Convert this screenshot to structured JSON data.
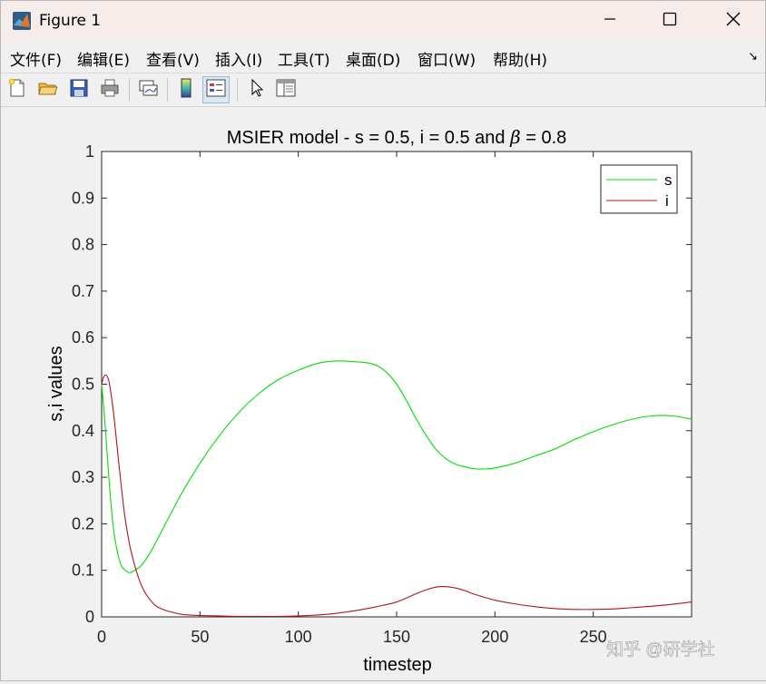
{
  "window": {
    "title": "Figure 1",
    "icon": "matlab-logo-icon",
    "controls": [
      "minimize-icon",
      "maximize-icon",
      "close-icon"
    ]
  },
  "menu": {
    "items": [
      "文件(F)",
      "编辑(E)",
      "查看(V)",
      "插入(I)",
      "工具(T)",
      "桌面(D)",
      "窗口(W)",
      "帮助(H)"
    ],
    "overflow_glyph": "↘"
  },
  "toolbar": {
    "buttons": [
      "new-figure-icon",
      "open-file-icon",
      "save-icon",
      "print-icon",
      "link-plot-icon",
      "colorbar-icon",
      "legend-icon",
      "edit-plot-icon",
      "property-inspector-icon"
    ],
    "active": "legend-icon"
  },
  "plot": {
    "title_prefix": "MSIER model - s = 0.5, i = 0.5 and ",
    "title_beta": "β",
    "title_suffix": " = 0.8",
    "xlabel": "timestep",
    "ylabel": "s,i values",
    "colors": {
      "s": "#00e000",
      "i": "#b0141e"
    }
  },
  "watermark": "知乎 @研学社",
  "chart_data": {
    "type": "line",
    "title": "MSIER model - s = 0.5, i = 0.5 and β = 0.8",
    "xlabel": "timestep",
    "ylabel": "s,i values",
    "xlim": [
      0,
      300
    ],
    "ylim": [
      0,
      1
    ],
    "xticks": [
      0,
      50,
      100,
      150,
      200,
      250
    ],
    "yticks": [
      0,
      0.1,
      0.2,
      0.3,
      0.4,
      0.5,
      0.6,
      0.7,
      0.8,
      0.9,
      1
    ],
    "legend": "top-right",
    "grid": false,
    "series": [
      {
        "name": "s",
        "x": [
          0,
          2,
          4,
          6,
          8,
          10,
          12,
          14,
          16,
          20,
          25,
          30,
          40,
          50,
          60,
          70,
          80,
          90,
          100,
          110,
          120,
          130,
          135,
          140,
          145,
          150,
          155,
          160,
          165,
          170,
          175,
          180,
          185,
          190,
          195,
          200,
          210,
          220,
          230,
          240,
          250,
          260,
          270,
          280,
          290,
          300
        ],
        "y": [
          0.5,
          0.4,
          0.28,
          0.19,
          0.14,
          0.11,
          0.1,
          0.095,
          0.098,
          0.11,
          0.14,
          0.18,
          0.26,
          0.33,
          0.39,
          0.44,
          0.48,
          0.51,
          0.53,
          0.545,
          0.55,
          0.548,
          0.546,
          0.54,
          0.525,
          0.5,
          0.465,
          0.425,
          0.39,
          0.36,
          0.34,
          0.328,
          0.322,
          0.318,
          0.318,
          0.32,
          0.33,
          0.345,
          0.36,
          0.38,
          0.398,
          0.413,
          0.425,
          0.432,
          0.432,
          0.425
        ]
      },
      {
        "name": "i",
        "x": [
          0,
          1,
          2,
          3,
          4,
          6,
          8,
          10,
          12,
          15,
          20,
          25,
          30,
          40,
          50,
          60,
          70,
          80,
          90,
          100,
          110,
          120,
          130,
          140,
          150,
          160,
          165,
          170,
          175,
          180,
          185,
          190,
          200,
          210,
          220,
          230,
          240,
          250,
          260,
          270,
          280,
          290,
          300
        ],
        "y": [
          0.5,
          0.515,
          0.52,
          0.515,
          0.5,
          0.44,
          0.36,
          0.28,
          0.21,
          0.14,
          0.07,
          0.035,
          0.018,
          0.006,
          0.003,
          0.002,
          0.001,
          0.001,
          0.001,
          0.002,
          0.004,
          0.008,
          0.014,
          0.022,
          0.032,
          0.05,
          0.058,
          0.064,
          0.065,
          0.062,
          0.056,
          0.048,
          0.036,
          0.028,
          0.022,
          0.018,
          0.016,
          0.016,
          0.017,
          0.02,
          0.023,
          0.027,
          0.032
        ]
      }
    ]
  }
}
